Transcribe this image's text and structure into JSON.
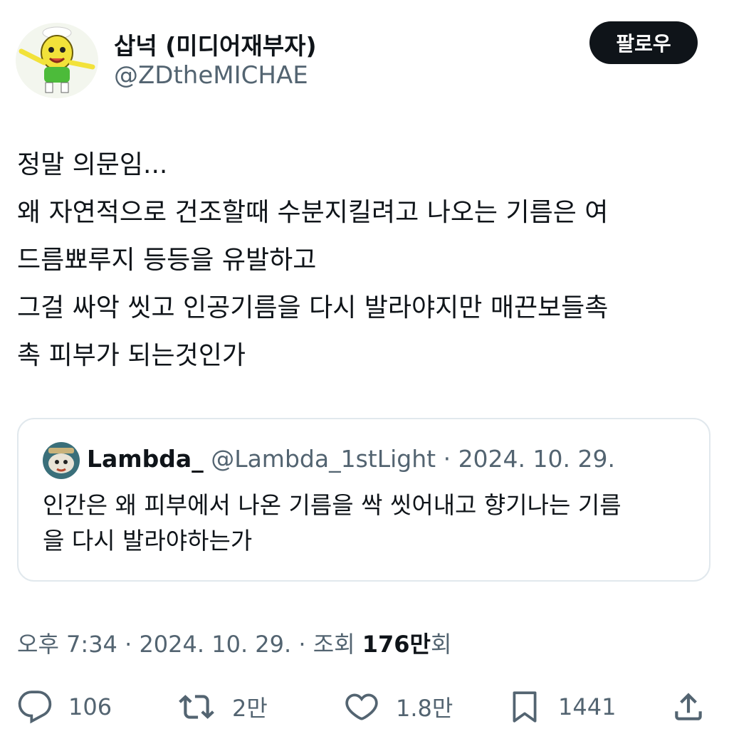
{
  "author": {
    "display_name": "삽넉 (미디어재부자)",
    "handle": "@ZDtheMICHAE",
    "avatar_icon": "cartoon-mascot-avatar"
  },
  "follow_button": {
    "label": "팔로우"
  },
  "tweet": {
    "lines": [
      "정말 의문임...",
      "왜 자연적으로 건조할때 수분지킬려고 나오는 기름은 여",
      "드름뾰루지 등등을 유발하고",
      "그걸 싸악 씻고 인공기름을 다시 발라야지만 매끈보들촉",
      "촉 피부가 되는것인가"
    ]
  },
  "quoted": {
    "display_name": "Lambda_",
    "handle": "@Lambda_1stLight",
    "separator": "·",
    "date": "2024. 10. 29.",
    "lines": [
      "인간은 왜 피부에서 나온 기름을 싹 씻어내고 향기나는 기름",
      "을 다시 발라야하는가"
    ]
  },
  "meta": {
    "time": "오후 7:34",
    "sep1": "·",
    "date": "2024. 10. 29.",
    "sep2": "·",
    "views_label": "조회",
    "views_count": "176만",
    "views_suffix": "회"
  },
  "actions": {
    "replies": "106",
    "retweets": "2만",
    "likes": "1.8만",
    "bookmarks": "1441"
  },
  "colors": {
    "text": "#0f1419",
    "secondary": "#536471",
    "border": "#e1e8ed",
    "button_bg": "#0f1419"
  }
}
